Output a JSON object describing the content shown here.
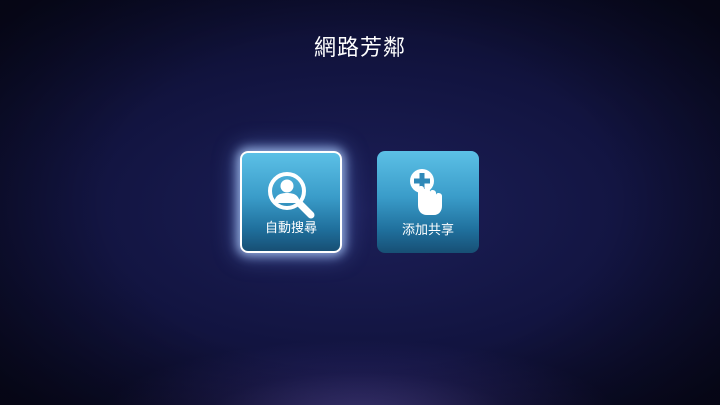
{
  "page": {
    "title": "網路芳鄰"
  },
  "tiles": [
    {
      "label": "自動搜尋",
      "icon": "user-search-icon",
      "selected": true
    },
    {
      "label": "添加共享",
      "icon": "hand-add-icon",
      "selected": false
    }
  ],
  "colors": {
    "background": "#121440",
    "tile_top": "#5cc0e6",
    "tile_bottom": "#174f74",
    "focus_border": "#ffffff"
  }
}
